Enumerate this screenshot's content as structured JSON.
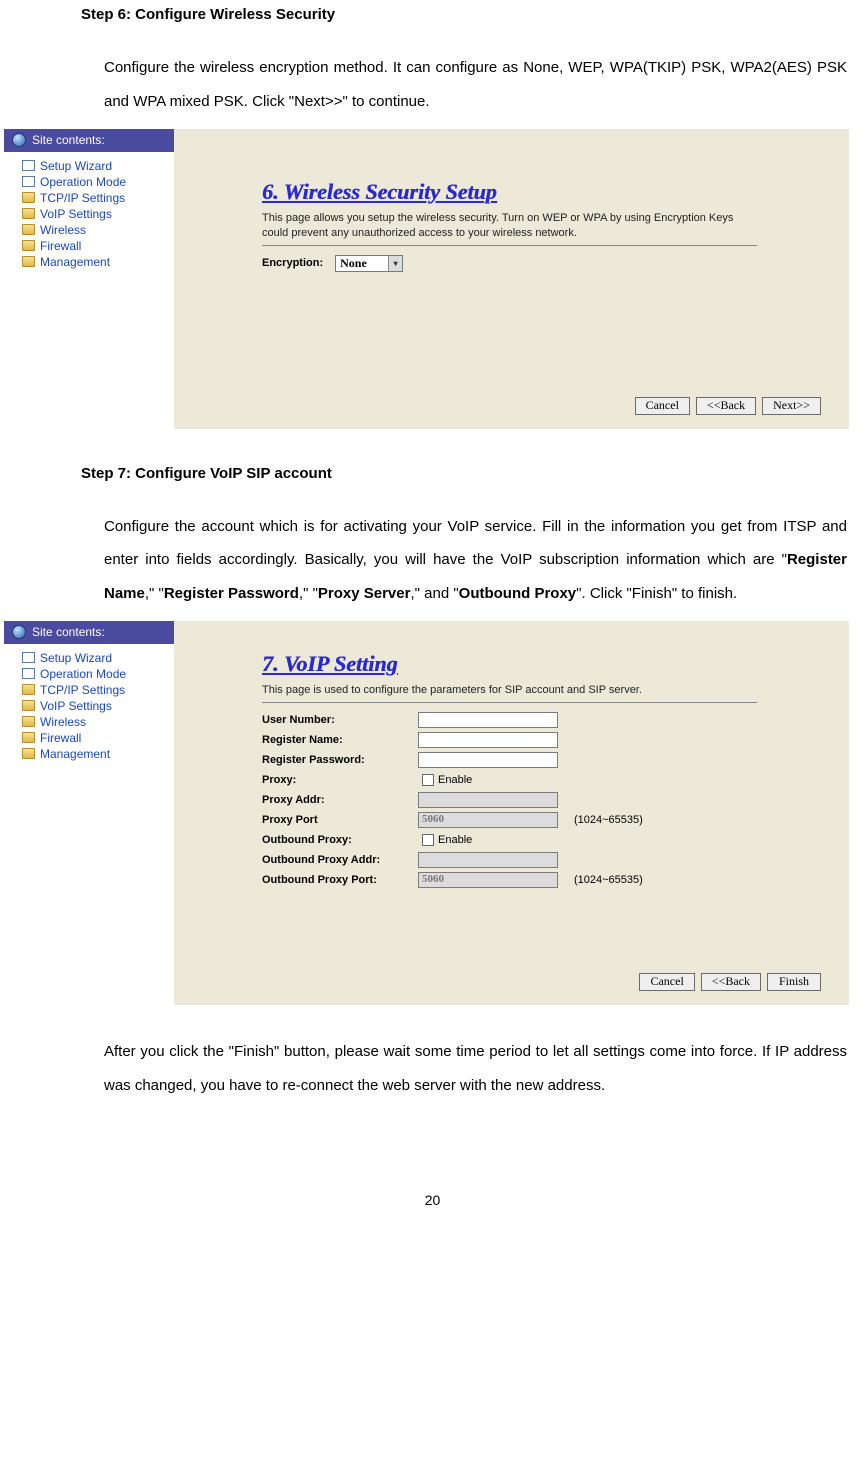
{
  "step6": {
    "heading": "Step 6: Configure Wireless Security",
    "paragraph_html": "Configure the wireless encryption method. It can configure as None, WEP, WPA(TKIP) PSK, WPA2(AES) PSK and WPA mixed PSK. Click \"Next>>\" to continue."
  },
  "sidebar": {
    "title": "Site contents:",
    "items": [
      {
        "label": "Setup Wizard",
        "icon": "page"
      },
      {
        "label": "Operation Mode",
        "icon": "page"
      },
      {
        "label": "TCP/IP Settings",
        "icon": "folder"
      },
      {
        "label": "VoIP Settings",
        "icon": "folder"
      },
      {
        "label": "Wireless",
        "icon": "folder"
      },
      {
        "label": "Firewall",
        "icon": "folder"
      },
      {
        "label": "Management",
        "icon": "folder"
      }
    ]
  },
  "panel6": {
    "title": "6. Wireless Security Setup",
    "desc": "This page allows you setup the wireless security. Turn on WEP or WPA by using Encryption Keys could prevent any unauthorized access to your wireless network.",
    "encryption_label": "Encryption:",
    "encryption_value": "None",
    "buttons": {
      "cancel": "Cancel",
      "back": "<<Back",
      "next": "Next>>"
    }
  },
  "step7": {
    "heading": "Step 7: Configure VoIP SIP account",
    "paragraph_prefix": "Configure the account which is for activating your VoIP service. Fill in the information you get from ITSP and enter into fields accordingly. Basically, you will have the VoIP subscription information which are \"",
    "register_name": "Register Name",
    "mid1": ",\" \"",
    "register_password": "Register Password",
    "mid2": ",\" \"",
    "proxy_server": "Proxy Server",
    "mid3": ",\" and \"",
    "outbound_proxy": "Outbound Proxy",
    "paragraph_suffix": "\". Click \"Finish\" to finish."
  },
  "panel7": {
    "title": "7. VoIP Setting",
    "desc": "This page is used to configure the parameters for SIP account and SIP server.",
    "fields": {
      "user_number": "User Number:",
      "register_name": "Register Name:",
      "register_password": "Register Password:",
      "proxy": "Proxy:",
      "proxy_enable": "Enable",
      "proxy_addr": "Proxy Addr:",
      "proxy_port": "Proxy Port",
      "proxy_port_value": "5060",
      "proxy_port_range": "(1024~65535)",
      "ob_proxy": "Outbound Proxy:",
      "ob_enable": "Enable",
      "ob_addr": "Outbound Proxy Addr:",
      "ob_port": "Outbound Proxy Port:",
      "ob_port_value": "5060",
      "ob_port_range": "(1024~65535)"
    },
    "buttons": {
      "cancel": "Cancel",
      "back": "<<Back",
      "finish": "Finish"
    }
  },
  "closing_paragraph": "After you click the \"Finish\" button, please wait some time period to let all settings come into force. If IP address was changed, you have to re-connect the web server with the new address.",
  "page_number": "20"
}
